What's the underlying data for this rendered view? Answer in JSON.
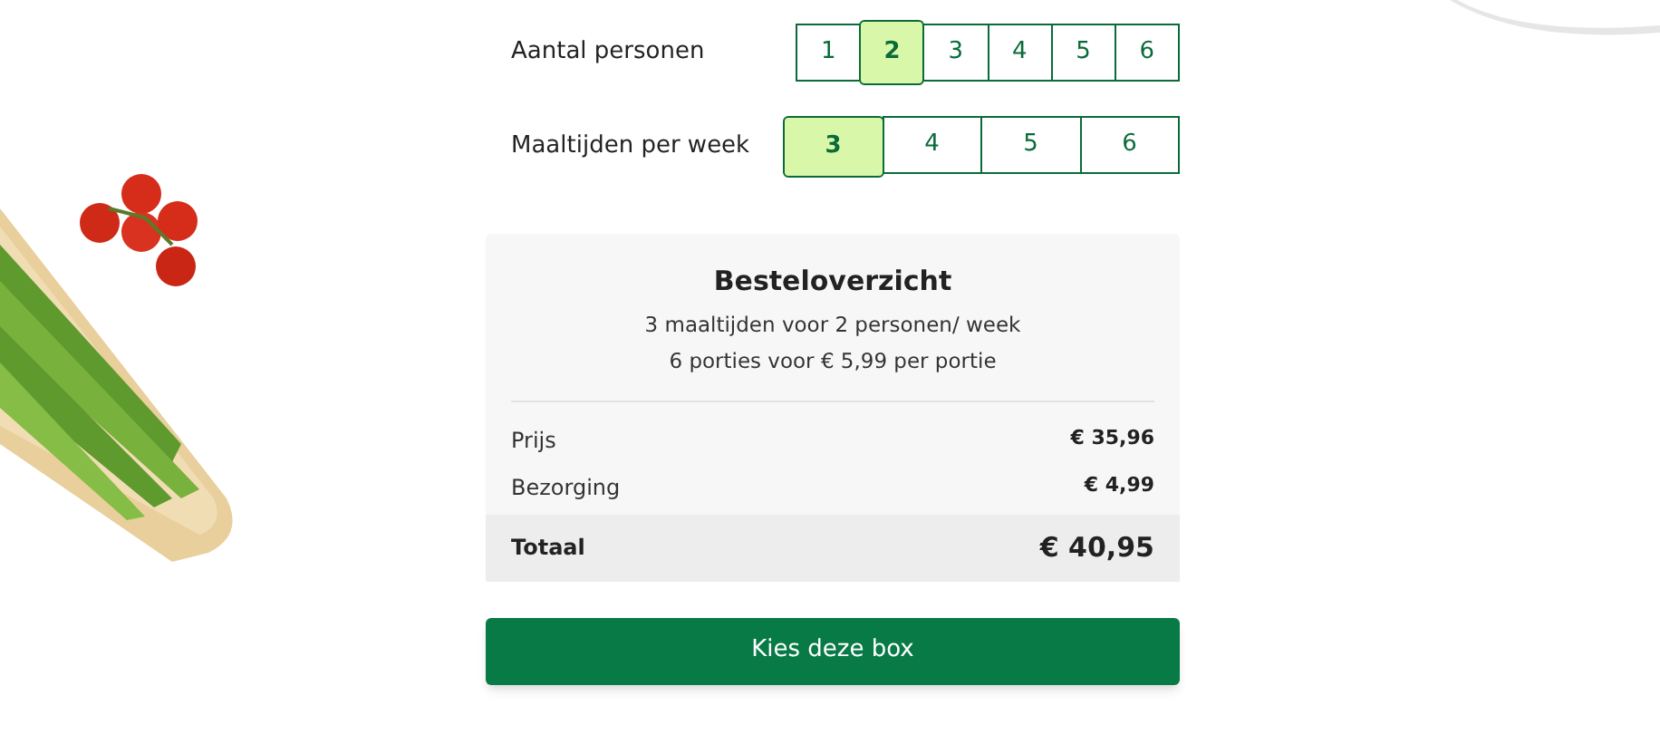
{
  "pickers": [
    {
      "label": "Aantal personen",
      "kind": "persons",
      "options": [
        {
          "label": "1",
          "selected": false
        },
        {
          "label": "2",
          "selected": true
        },
        {
          "label": "3",
          "selected": false
        },
        {
          "label": "4",
          "selected": false
        },
        {
          "label": "5",
          "selected": false
        },
        {
          "label": "6",
          "selected": false
        }
      ]
    },
    {
      "label": "Maaltijden per week",
      "kind": "meals",
      "options": [
        {
          "label": "3",
          "selected": true
        },
        {
          "label": "4",
          "selected": false
        },
        {
          "label": "5",
          "selected": false
        },
        {
          "label": "6",
          "selected": false
        }
      ]
    }
  ],
  "summary": {
    "title": "Besteloverzicht",
    "lines": [
      "3 maaltijden voor 2 personen/ week",
      "6 porties voor € 5,99 per portie"
    ],
    "rows": [
      {
        "label": "Prijs",
        "value": "€ 35,96"
      },
      {
        "label": "Bezorging",
        "value": "€ 4,99"
      }
    ],
    "total": {
      "label": "Totaal",
      "value": "€ 40,95"
    }
  },
  "button": "Kies deze box"
}
